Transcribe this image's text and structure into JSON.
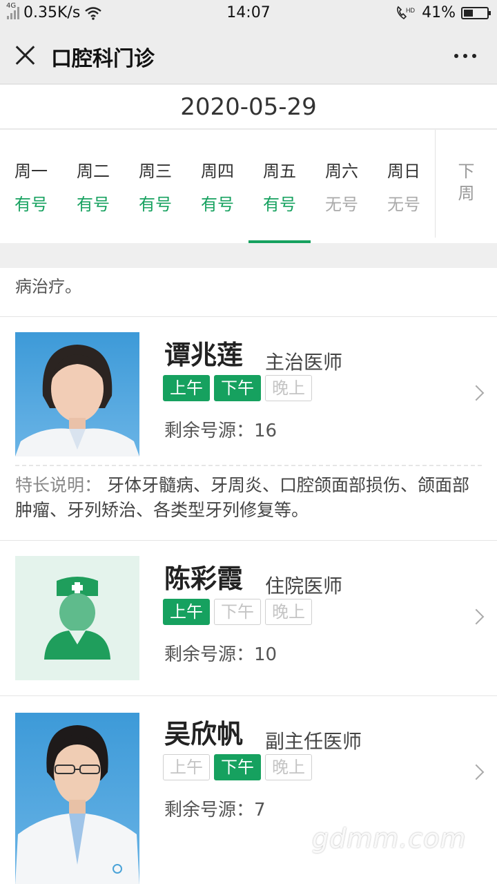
{
  "status_bar": {
    "network": "4G",
    "speed": "0.35K/s",
    "time": "14:07",
    "hd": "HD",
    "battery_percent": "41%",
    "battery_level": 0.41
  },
  "nav": {
    "title": "口腔科门诊"
  },
  "date": "2020-05-29",
  "week": [
    {
      "day": "周一",
      "availability": "有号",
      "available": true
    },
    {
      "day": "周二",
      "availability": "有号",
      "available": true
    },
    {
      "day": "周三",
      "availability": "有号",
      "available": true
    },
    {
      "day": "周四",
      "availability": "有号",
      "available": true
    },
    {
      "day": "周五",
      "availability": "有号",
      "available": true,
      "selected": true
    },
    {
      "day": "周六",
      "availability": "无号",
      "available": false
    },
    {
      "day": "周日",
      "availability": "无号",
      "available": false
    }
  ],
  "next_week": [
    "下",
    "周"
  ],
  "previous_specialty_tail": "病治疗。",
  "doctors": [
    {
      "name": "谭兆莲",
      "title": "主治医师",
      "sessions": [
        {
          "label": "上午",
          "available": true
        },
        {
          "label": "下午",
          "available": true
        },
        {
          "label": "晚上",
          "available": false
        }
      ],
      "remaining_label": "剩余号源：16",
      "specialty_label": "特长说明：",
      "specialty": "牙体牙髓病、牙周炎、口腔颌面部损伤、颌面部肿瘤、牙列矫治、各类型牙列修复等。"
    },
    {
      "name": "陈彩霞",
      "title": "住院医师",
      "sessions": [
        {
          "label": "上午",
          "available": true
        },
        {
          "label": "下午",
          "available": false
        },
        {
          "label": "晚上",
          "available": false
        }
      ],
      "remaining_label": "剩余号源：10"
    },
    {
      "name": "吴欣帆",
      "title": "副主任医师",
      "sessions": [
        {
          "label": "上午",
          "available": false
        },
        {
          "label": "下午",
          "available": true
        },
        {
          "label": "晚上",
          "available": false
        }
      ],
      "remaining_label": "剩余号源：7"
    }
  ],
  "watermark": "gdmm.com",
  "colors": {
    "accent": "#16a15f",
    "muted": "#aaaaaa"
  }
}
